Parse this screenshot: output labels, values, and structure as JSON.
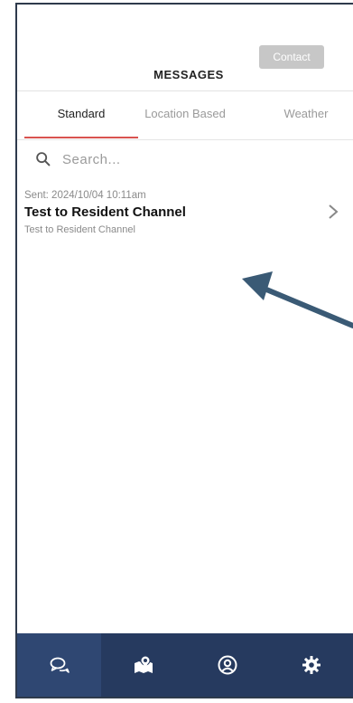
{
  "header": {
    "title": "MESSAGES",
    "contact_label": "Contact"
  },
  "tabs": [
    {
      "label": "Standard",
      "active": true
    },
    {
      "label": "Location Based",
      "active": false
    },
    {
      "label": "Weather",
      "active": false
    }
  ],
  "search": {
    "placeholder": "Search..."
  },
  "messages": [
    {
      "sent": "Sent: 2024/10/04 10:11am",
      "title": "Test to Resident Channel",
      "subtitle": "Test to Resident Channel"
    }
  ],
  "bottom_nav": [
    {
      "icon": "chat-bubbles-icon",
      "active": true
    },
    {
      "icon": "map-pin-icon",
      "active": false
    },
    {
      "icon": "user-circle-icon",
      "active": false
    },
    {
      "icon": "gear-icon",
      "active": false
    }
  ],
  "colors": {
    "nav_bg": "#263a5f",
    "nav_active": "#2f4772",
    "tab_underline": "#d9534f",
    "contact_bg": "#c7c7c7",
    "arrow": "#3a5a75"
  }
}
